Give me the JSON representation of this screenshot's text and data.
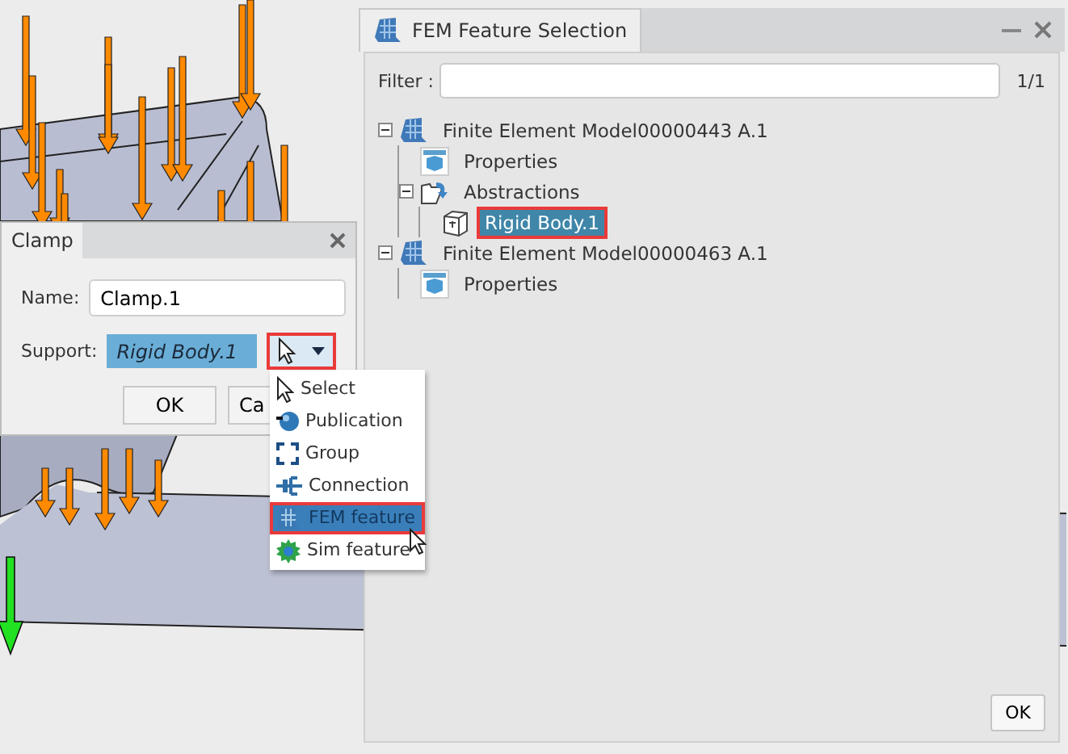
{
  "panel": {
    "title": "FEM Feature Selection",
    "filter": {
      "label": "Filter :",
      "count": "1/1"
    },
    "tree": [
      {
        "label": "Finite Element Model00000443 A.1",
        "kind": "model",
        "expanded": true,
        "selected": false,
        "highlighted": false,
        "children": [
          {
            "label": "Properties",
            "kind": "properties",
            "selected": false,
            "highlighted": false
          },
          {
            "label": "Abstractions",
            "kind": "abstractions",
            "expanded": true,
            "selected": false,
            "highlighted": false,
            "children": [
              {
                "label": "Rigid Body.1",
                "kind": "rigid_body",
                "selected": true,
                "highlighted": true
              }
            ]
          }
        ]
      },
      {
        "label": "Finite Element Model00000463 A.1",
        "kind": "model",
        "expanded": true,
        "selected": false,
        "highlighted": false,
        "children": [
          {
            "label": "Properties",
            "kind": "properties",
            "selected": false,
            "highlighted": false
          }
        ]
      }
    ],
    "ok": "OK"
  },
  "clamp": {
    "title": "Clamp",
    "name_label": "Name:",
    "name_value": "Clamp.1",
    "support_label": "Support:",
    "support_value": "Rigid Body.1",
    "support_button_highlighted": true,
    "buttons": [
      "OK",
      "Ca"
    ]
  },
  "menu": [
    {
      "label": "Select",
      "kind": "select",
      "selected": false,
      "highlighted": false
    },
    {
      "label": "Publication",
      "kind": "publication",
      "selected": false,
      "highlighted": false
    },
    {
      "label": "Group",
      "kind": "group",
      "selected": false,
      "highlighted": false
    },
    {
      "label": "Connection",
      "kind": "connection",
      "selected": false,
      "highlighted": false
    },
    {
      "label": "FEM feature",
      "kind": "fem",
      "selected": true,
      "highlighted": true
    },
    {
      "label": "Sim feature",
      "kind": "sim",
      "selected": false,
      "highlighted": false
    }
  ]
}
